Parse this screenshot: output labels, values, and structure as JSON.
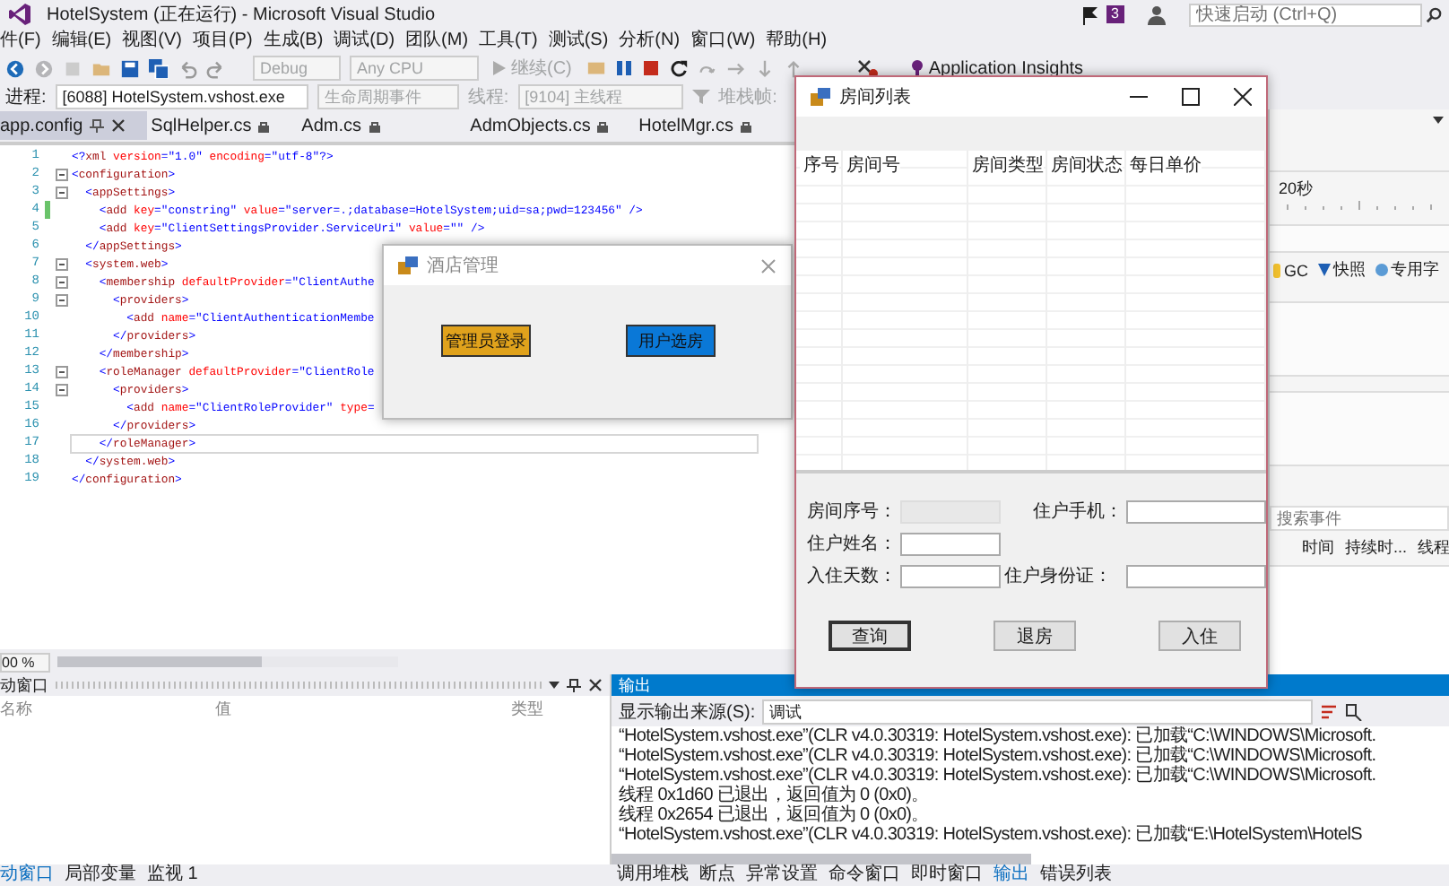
{
  "window": {
    "title": "HotelSystem (正在运行) - Microsoft Visual Studio",
    "notifications": "3",
    "quick_launch": {
      "placeholder": "快速启动 (Ctrl+Q)"
    }
  },
  "menu": [
    "件(F)",
    "编辑(E)",
    "视图(V)",
    "项目(P)",
    "生成(B)",
    "调试(D)",
    "团队(M)",
    "工具(T)",
    "测试(S)",
    "分析(N)",
    "窗口(W)",
    "帮助(H)"
  ],
  "toolbar": {
    "configuration": {
      "label": "Debug",
      "disabled": true
    },
    "platform": {
      "label": "Any CPU",
      "disabled": true
    },
    "continue": {
      "label": "继续(C)",
      "disabled": true
    },
    "insights": {
      "label": "Application Insights"
    }
  },
  "debug_location": {
    "process_label": "进程:",
    "process": "[6088] HotelSystem.vshost.exe",
    "lifecycle": {
      "label": "生命周期事件",
      "disabled": true
    },
    "thread_label": {
      "label": "线程:",
      "disabled": true
    },
    "thread": {
      "label": "[9104] 主线程",
      "disabled": true
    },
    "stack_label": {
      "label": "堆栈帧:",
      "disabled": true
    }
  },
  "editor": {
    "tabs": [
      {
        "label": "app.config",
        "selected": true
      },
      {
        "label": "SqlHelper.cs",
        "selected": false
      },
      {
        "label": "Adm.cs",
        "selected": false
      },
      {
        "label": "AdmObjects.cs",
        "selected": false
      },
      {
        "label": "HotelMgr.cs",
        "selected": false
      }
    ],
    "lines": [
      {
        "number": "1",
        "fold": false,
        "changed": false,
        "current": false,
        "segments": [
          {
            "kind": "punct",
            "text": "<?"
          },
          {
            "kind": "tag",
            "text": "xml"
          },
          {
            "kind": "attr",
            "text": " version"
          },
          {
            "kind": "punct",
            "text": "=\""
          },
          {
            "kind": "value",
            "text": "1.0"
          },
          {
            "kind": "punct",
            "text": "\""
          },
          {
            "kind": "attr",
            "text": " encoding"
          },
          {
            "kind": "punct",
            "text": "=\""
          },
          {
            "kind": "value",
            "text": "utf-8"
          },
          {
            "kind": "punct",
            "text": "\"?>"
          }
        ]
      },
      {
        "number": "2",
        "fold": true,
        "changed": false,
        "current": false,
        "segments": [
          {
            "kind": "punct",
            "text": "<"
          },
          {
            "kind": "tag",
            "text": "configuration"
          },
          {
            "kind": "punct",
            "text": ">"
          }
        ]
      },
      {
        "number": "3",
        "fold": true,
        "changed": false,
        "current": false,
        "segments": [
          {
            "kind": "punct",
            "text": "  <"
          },
          {
            "kind": "tag",
            "text": "appSettings"
          },
          {
            "kind": "punct",
            "text": ">"
          }
        ]
      },
      {
        "number": "4",
        "fold": false,
        "changed": true,
        "current": false,
        "segments": [
          {
            "kind": "punct",
            "text": "    <"
          },
          {
            "kind": "tag",
            "text": "add"
          },
          {
            "kind": "attr",
            "text": " key"
          },
          {
            "kind": "punct",
            "text": "=\""
          },
          {
            "kind": "value",
            "text": "constring"
          },
          {
            "kind": "punct",
            "text": "\""
          },
          {
            "kind": "attr",
            "text": " value"
          },
          {
            "kind": "punct",
            "text": "=\""
          },
          {
            "kind": "value",
            "text": "server=.;database=HotelSystem;uid=sa;pwd=123456"
          },
          {
            "kind": "punct",
            "text": "\" />"
          }
        ]
      },
      {
        "number": "5",
        "fold": false,
        "changed": false,
        "current": false,
        "segments": [
          {
            "kind": "punct",
            "text": "    <"
          },
          {
            "kind": "tag",
            "text": "add"
          },
          {
            "kind": "attr",
            "text": " key"
          },
          {
            "kind": "punct",
            "text": "=\""
          },
          {
            "kind": "value",
            "text": "ClientSettingsProvider.ServiceUri"
          },
          {
            "kind": "punct",
            "text": "\""
          },
          {
            "kind": "attr",
            "text": " value"
          },
          {
            "kind": "punct",
            "text": "=\"\" />"
          }
        ]
      },
      {
        "number": "6",
        "fold": false,
        "changed": false,
        "current": false,
        "segments": [
          {
            "kind": "punct",
            "text": "  </"
          },
          {
            "kind": "tag",
            "text": "appSettings"
          },
          {
            "kind": "punct",
            "text": ">"
          }
        ]
      },
      {
        "number": "7",
        "fold": true,
        "changed": false,
        "current": false,
        "segments": [
          {
            "kind": "punct",
            "text": "  <"
          },
          {
            "kind": "tag",
            "text": "system.web"
          },
          {
            "kind": "punct",
            "text": ">"
          }
        ]
      },
      {
        "number": "8",
        "fold": true,
        "changed": false,
        "current": false,
        "segments": [
          {
            "kind": "punct",
            "text": "    <"
          },
          {
            "kind": "tag",
            "text": "membership"
          },
          {
            "kind": "attr",
            "text": " defaultProvider"
          },
          {
            "kind": "punct",
            "text": "=\""
          },
          {
            "kind": "value",
            "text": "ClientAuthe"
          }
        ]
      },
      {
        "number": "9",
        "fold": true,
        "changed": false,
        "current": false,
        "segments": [
          {
            "kind": "punct",
            "text": "      <"
          },
          {
            "kind": "tag",
            "text": "providers"
          },
          {
            "kind": "punct",
            "text": ">"
          }
        ]
      },
      {
        "number": "10",
        "fold": false,
        "changed": false,
        "current": false,
        "segments": [
          {
            "kind": "punct",
            "text": "        <"
          },
          {
            "kind": "tag",
            "text": "add"
          },
          {
            "kind": "attr",
            "text": " name"
          },
          {
            "kind": "punct",
            "text": "=\""
          },
          {
            "kind": "value",
            "text": "ClientAuthenticationMembe"
          }
        ]
      },
      {
        "number": "11",
        "fold": false,
        "changed": false,
        "current": false,
        "segments": [
          {
            "kind": "punct",
            "text": "      </"
          },
          {
            "kind": "tag",
            "text": "providers"
          },
          {
            "kind": "punct",
            "text": ">"
          }
        ]
      },
      {
        "number": "12",
        "fold": false,
        "changed": false,
        "current": false,
        "segments": [
          {
            "kind": "punct",
            "text": "    </"
          },
          {
            "kind": "tag",
            "text": "membership"
          },
          {
            "kind": "punct",
            "text": ">"
          }
        ]
      },
      {
        "number": "13",
        "fold": true,
        "changed": false,
        "current": false,
        "segments": [
          {
            "kind": "punct",
            "text": "    <"
          },
          {
            "kind": "tag",
            "text": "roleManager"
          },
          {
            "kind": "attr",
            "text": " defaultProvider"
          },
          {
            "kind": "punct",
            "text": "=\""
          },
          {
            "kind": "value",
            "text": "ClientRole"
          }
        ]
      },
      {
        "number": "14",
        "fold": true,
        "changed": false,
        "current": false,
        "segments": [
          {
            "kind": "punct",
            "text": "      <"
          },
          {
            "kind": "tag",
            "text": "providers"
          },
          {
            "kind": "punct",
            "text": ">"
          }
        ]
      },
      {
        "number": "15",
        "fold": false,
        "changed": false,
        "current": false,
        "segments": [
          {
            "kind": "punct",
            "text": "        <"
          },
          {
            "kind": "tag",
            "text": "add"
          },
          {
            "kind": "attr",
            "text": " name"
          },
          {
            "kind": "punct",
            "text": "=\""
          },
          {
            "kind": "value",
            "text": "ClientRoleProvider"
          },
          {
            "kind": "punct",
            "text": "\""
          },
          {
            "kind": "attr",
            "text": " type"
          },
          {
            "kind": "punct",
            "text": "="
          }
        ]
      },
      {
        "number": "16",
        "fold": false,
        "changed": false,
        "current": false,
        "segments": [
          {
            "kind": "punct",
            "text": "      </"
          },
          {
            "kind": "tag",
            "text": "providers"
          },
          {
            "kind": "punct",
            "text": ">"
          }
        ]
      },
      {
        "number": "17",
        "fold": false,
        "changed": false,
        "current": true,
        "segments": [
          {
            "kind": "punct",
            "text": "    </"
          },
          {
            "kind": "tag",
            "text": "roleManager"
          },
          {
            "kind": "punct",
            "text": ">"
          }
        ]
      },
      {
        "number": "18",
        "fold": false,
        "changed": false,
        "current": false,
        "segments": [
          {
            "kind": "punct",
            "text": "  </"
          },
          {
            "kind": "tag",
            "text": "system.web"
          },
          {
            "kind": "punct",
            "text": ">"
          }
        ]
      },
      {
        "number": "19",
        "fold": false,
        "changed": false,
        "current": false,
        "segments": [
          {
            "kind": "punct",
            "text": "</"
          },
          {
            "kind": "tag",
            "text": "configuration"
          },
          {
            "kind": "punct",
            "text": ">"
          }
        ]
      }
    ],
    "zoom": "00 %"
  },
  "diagnostics": {
    "time_label": "20秒",
    "legend": [
      {
        "kind": "bar",
        "label": "GC",
        "color": "#f2c12e"
      },
      {
        "kind": "triangle",
        "label": "快照",
        "color": "#1e5fb4"
      },
      {
        "kind": "dot",
        "label": "专用字",
        "color": "#5b9bd5"
      }
    ],
    "search": {
      "placeholder": "搜索事件"
    },
    "columns": [
      "时间",
      "持续时...",
      "线程"
    ]
  },
  "locals": {
    "title": "动窗口",
    "columns": [
      "名称",
      "值",
      "类型"
    ]
  },
  "output": {
    "title": "输出",
    "source_label": "显示输出来源(S):",
    "source": "调试",
    "lines": [
      "“HotelSystem.vshost.exe”(CLR v4.0.30319: HotelSystem.vshost.exe): 已加载“C:\\WINDOWS\\Microsoft.",
      "“HotelSystem.vshost.exe”(CLR v4.0.30319: HotelSystem.vshost.exe): 已加载“C:\\WINDOWS\\Microsoft.",
      "“HotelSystem.vshost.exe”(CLR v4.0.30319: HotelSystem.vshost.exe): 已加载“C:\\WINDOWS\\Microsoft.",
      "线程 0x1d60 已退出，返回值为 0 (0x0)。",
      "线程 0x2654 已退出，返回值为 0 (0x0)。",
      "“HotelSystem.vshost.exe”(CLR v4.0.30319: HotelSystem.vshost.exe): 已加载“E:\\HotelSystem\\HotelS"
    ]
  },
  "bottom_tabs": {
    "left": [
      {
        "label": "动窗口",
        "selected": true
      },
      {
        "label": "局部变量",
        "selected": false
      },
      {
        "label": "监视 1",
        "selected": false
      }
    ],
    "right": [
      {
        "label": "调用堆栈",
        "selected": false
      },
      {
        "label": "断点",
        "selected": false
      },
      {
        "label": "异常设置",
        "selected": false
      },
      {
        "label": "命令窗口",
        "selected": false
      },
      {
        "label": "即时窗口",
        "selected": false
      },
      {
        "label": "输出",
        "selected": true
      },
      {
        "label": "错误列表",
        "selected": false
      }
    ]
  },
  "hotel_window": {
    "title": "酒店管理",
    "buttons": [
      {
        "label": "管理员登录",
        "color": "#e0a21c"
      },
      {
        "label": "用户选房",
        "color": "#0a78d7"
      }
    ]
  },
  "room_window": {
    "title": "房间列表",
    "columns": [
      "序号",
      "房间号",
      "房间类型",
      "房间状态",
      "每日单价"
    ],
    "fields": [
      {
        "label": "房间序号：",
        "disabled": true
      },
      {
        "label": "住户手机：",
        "disabled": false
      },
      {
        "label": "住户姓名：",
        "disabled": false
      },
      {
        "label": "入住天数：",
        "disabled": false
      },
      {
        "label": "住户身份证：",
        "disabled": false
      }
    ],
    "buttons": [
      {
        "label": "查询",
        "focused": true
      },
      {
        "label": "退房",
        "focused": false
      },
      {
        "label": "入住",
        "focused": false
      }
    ]
  }
}
